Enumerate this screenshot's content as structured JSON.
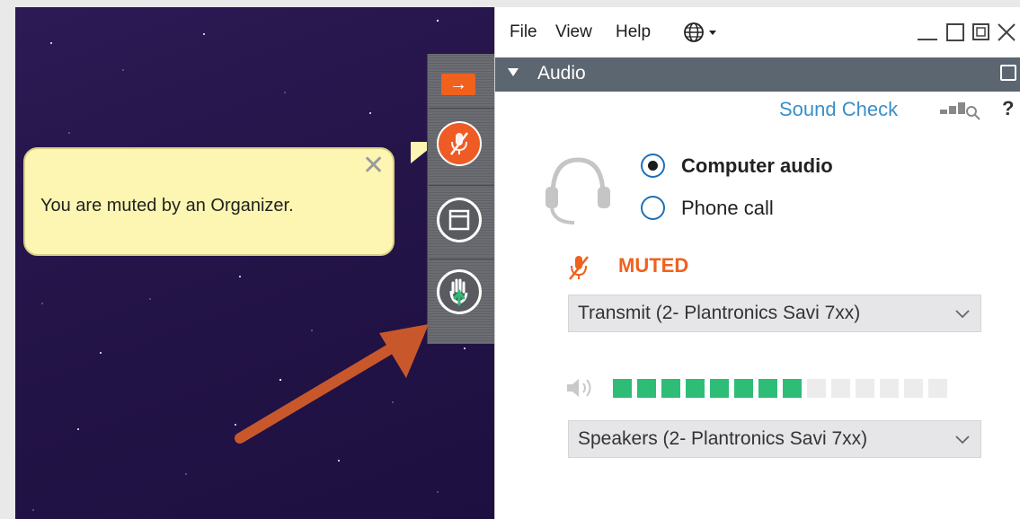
{
  "tooltip": {
    "message": "You are muted by an Organizer."
  },
  "menu": {
    "file": "File",
    "view": "View",
    "help": "Help"
  },
  "audio_panel": {
    "header": "Audio",
    "sound_check": "Sound Check",
    "help": "?",
    "options": [
      {
        "label": "Computer audio",
        "selected": true
      },
      {
        "label": "Phone call",
        "selected": false
      }
    ],
    "status": "MUTED",
    "transmit_device": "Transmit (2- Plantronics Savi 7xx)",
    "speaker_device": "Speakers (2- Plantronics Savi 7xx)",
    "speaker_level": {
      "active_segments": 8,
      "total_segments": 14
    }
  },
  "colors": {
    "accent_orange": "#f0611e",
    "meter_green": "#2ebd76",
    "link_blue": "#3a8fc7",
    "header_gray": "#5c6670"
  },
  "icons": [
    "arrow-right-icon",
    "mic-muted-icon",
    "window-icon",
    "raise-hand-icon",
    "globe-icon",
    "headset-icon",
    "speaker-icon",
    "chevron-down-icon",
    "close-icon"
  ]
}
